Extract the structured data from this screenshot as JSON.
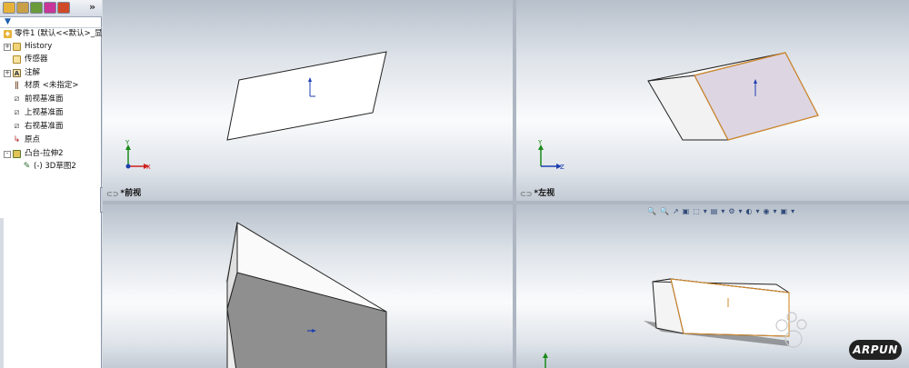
{
  "feature_tree": {
    "tabs": [
      "feature-manager",
      "property-manager",
      "configuration-manager",
      "dimxpert",
      "display-manager"
    ],
    "expand_glyph": "»",
    "items": [
      {
        "label": "零件1 (默认<<默认>_显",
        "icon": "part-icon",
        "indent": 0,
        "expander": ""
      },
      {
        "label": "History",
        "icon": "history-folder-icon",
        "indent": 1,
        "expander": "+"
      },
      {
        "label": "传感器",
        "icon": "sensor-folder-icon",
        "indent": 1,
        "expander": ""
      },
      {
        "label": "注解",
        "icon": "annotation-icon",
        "indent": 1,
        "expander": "+"
      },
      {
        "label": "材质 <未指定>",
        "icon": "material-icon",
        "indent": 1,
        "expander": ""
      },
      {
        "label": "前视基准面",
        "icon": "plane-icon",
        "indent": 1,
        "expander": ""
      },
      {
        "label": "上视基准面",
        "icon": "plane-icon",
        "indent": 1,
        "expander": ""
      },
      {
        "label": "右视基准面",
        "icon": "plane-icon",
        "indent": 1,
        "expander": ""
      },
      {
        "label": "原点",
        "icon": "origin-icon",
        "indent": 1,
        "expander": ""
      },
      {
        "label": "凸台-拉伸2",
        "icon": "extrude-icon",
        "indent": 1,
        "expander": "-"
      },
      {
        "label": "(-) 3D草图2",
        "icon": "sketch-3d-icon",
        "indent": 2,
        "expander": ""
      }
    ]
  },
  "viewports": {
    "front": {
      "label": "*前视"
    },
    "left": {
      "label": "*左视"
    }
  },
  "axes": {
    "x": "X",
    "y": "Y",
    "z": "Z"
  },
  "view_toolbar_icons": [
    "🔍",
    "🔍",
    "↗",
    "▣",
    "⬚",
    "▾",
    "▤",
    "▾",
    "⚙",
    "▾",
    "◐",
    "▾",
    "◉",
    "▾",
    "▣",
    "▾"
  ],
  "watermark": "ARPUN",
  "colors": {
    "accent_face": "#ddd6e2",
    "edge_orange": "#d48a2c",
    "axis_x": "#d02020",
    "axis_y": "#1a8a1a",
    "axis_z": "#1f3fb0"
  }
}
